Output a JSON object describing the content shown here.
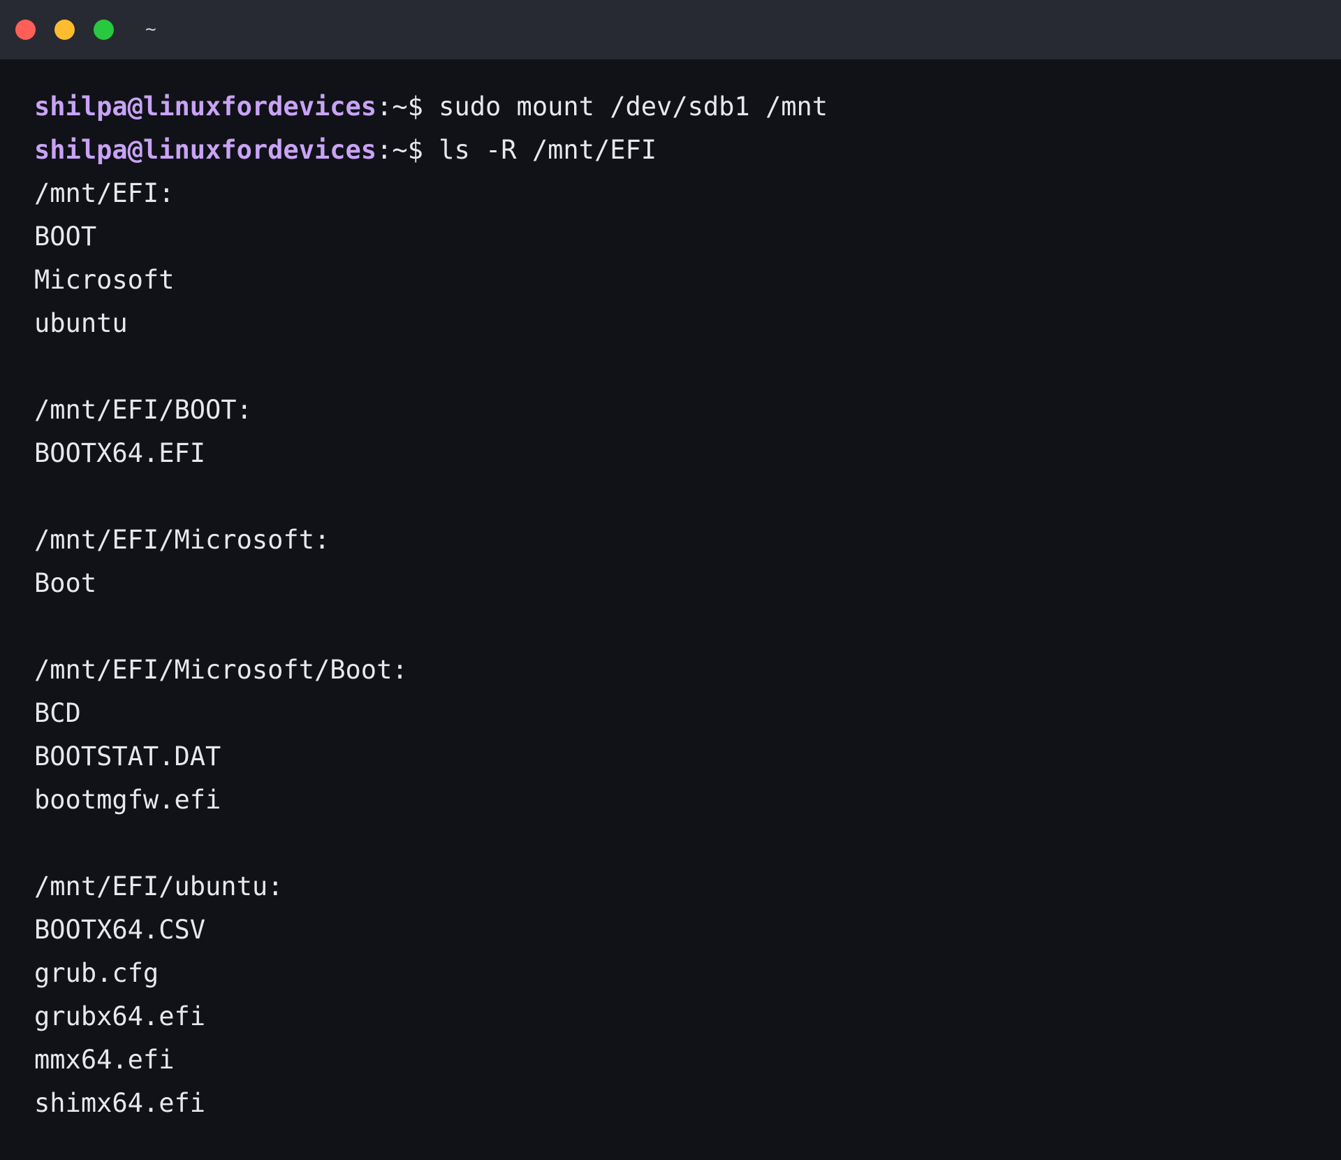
{
  "window": {
    "title": "~",
    "buttons": {
      "close_color": "#ff5f57",
      "minimize_color": "#febc2e",
      "maximize_color": "#28c840"
    }
  },
  "colors": {
    "background": "#101217",
    "titlebar": "#272a33",
    "prompt_user": "#c9a3f6",
    "text": "#e8e8ec"
  },
  "terminal": {
    "commands": [
      {
        "user_host": "shilpa@linuxfordevices",
        "path_sep": ":~$",
        "command": " sudo mount /dev/sdb1 /mnt"
      },
      {
        "user_host": "shilpa@linuxfordevices",
        "path_sep": ":~$",
        "command": " ls -R /mnt/EFI"
      }
    ],
    "output": [
      "/mnt/EFI:",
      "BOOT",
      "Microsoft",
      "ubuntu",
      "",
      "/mnt/EFI/BOOT:",
      "BOOTX64.EFI",
      "",
      "/mnt/EFI/Microsoft:",
      "Boot",
      "",
      "/mnt/EFI/Microsoft/Boot:",
      "BCD",
      "BOOTSTAT.DAT",
      "bootmgfw.efi",
      "",
      "/mnt/EFI/ubuntu:",
      "BOOTX64.CSV",
      "grub.cfg",
      "grubx64.efi",
      "mmx64.efi",
      "shimx64.efi"
    ]
  }
}
